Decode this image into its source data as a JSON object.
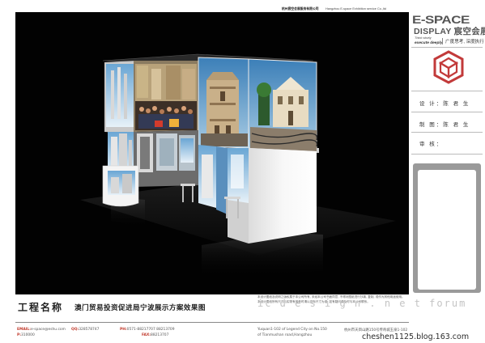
{
  "header": {
    "company_cn": "杭州宸空会展服务有限公司",
    "company_en": "Hangzhou E-space Exhibition service Co.,ltd"
  },
  "brand": {
    "name_line1": "E-SPACE",
    "name_line2": "DISPLAY 宸空会展",
    "tagline_think": "Think wisely",
    "tagline_execute": "execute deeply",
    "tagline_cn": "广度思考, 深度执行",
    "logo_color": "#c23a3a"
  },
  "info": {
    "design_label": "设 计：陈 君 生",
    "drafting_label": "制 图：陈 君 生",
    "review_label": "审 核："
  },
  "notice": {
    "line1": "本设计图纸及说明之版权属于本公司所有, 未经本公司书面同意, 不得对图纸进行抄袭, 复制, 或作为其他用途使用。",
    "line2": "本设计图纸所有尺寸与实物有偏差时请以实际尺寸为准, 如有疑问请及时与本公司联系。"
  },
  "project": {
    "label": "工程名称",
    "title": "澳门贸易投资促进局宁波展示方案效果图"
  },
  "watermarks": {
    "forum": "ic d e s i g n . n e t  forum",
    "blog": "cheshen1125.blog.163.com"
  },
  "footer": {
    "email_key": "EMAIL:",
    "email_value": "e-space@eshu.com",
    "qq_key": "QQ:",
    "qq_value": "328578747",
    "p_key": "P:",
    "p_value": "310000",
    "phone_key": "PH:",
    "phone_value": "0571-88217707 88213709",
    "fax_key": "FAX:",
    "fax_value": "88213707",
    "address_line1": "Yuquan1-102 of Legend City on No.150",
    "address_line2": "of Tianmushan road,Hangzhou",
    "address_cn": "杭州市天目山路150号传奇城玉泉1-102"
  }
}
